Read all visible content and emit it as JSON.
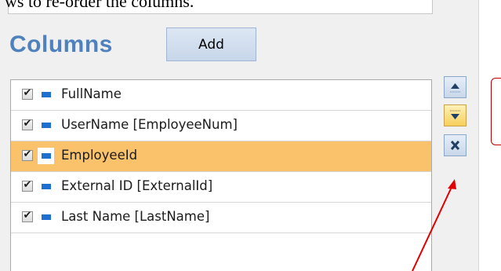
{
  "caption": {
    "text": "ws to re-order the columns."
  },
  "columns_panel": {
    "header": "Columns",
    "add_label": "Add",
    "rows": [
      {
        "label": "FullName",
        "checked": true,
        "selected": false
      },
      {
        "label": "UserName [EmployeeNum]",
        "checked": true,
        "selected": false
      },
      {
        "label": "EmployeeId",
        "checked": true,
        "selected": true
      },
      {
        "label": "External ID [ExternalId]",
        "checked": true,
        "selected": false
      },
      {
        "label": "Last Name [LastName]",
        "checked": true,
        "selected": false
      }
    ]
  },
  "side_buttons": {
    "move_up_icon": "triangle-up-icon",
    "move_down_icon": "triangle-down-icon",
    "remove_icon": "x-icon"
  },
  "annotations": {
    "bracket_color": "#c00000",
    "arrow_color": "#e00000"
  },
  "colors": {
    "header_blue": "#4f81bd",
    "selected_row": "#fac26b",
    "field_icon_blue": "#1f6fcf"
  }
}
